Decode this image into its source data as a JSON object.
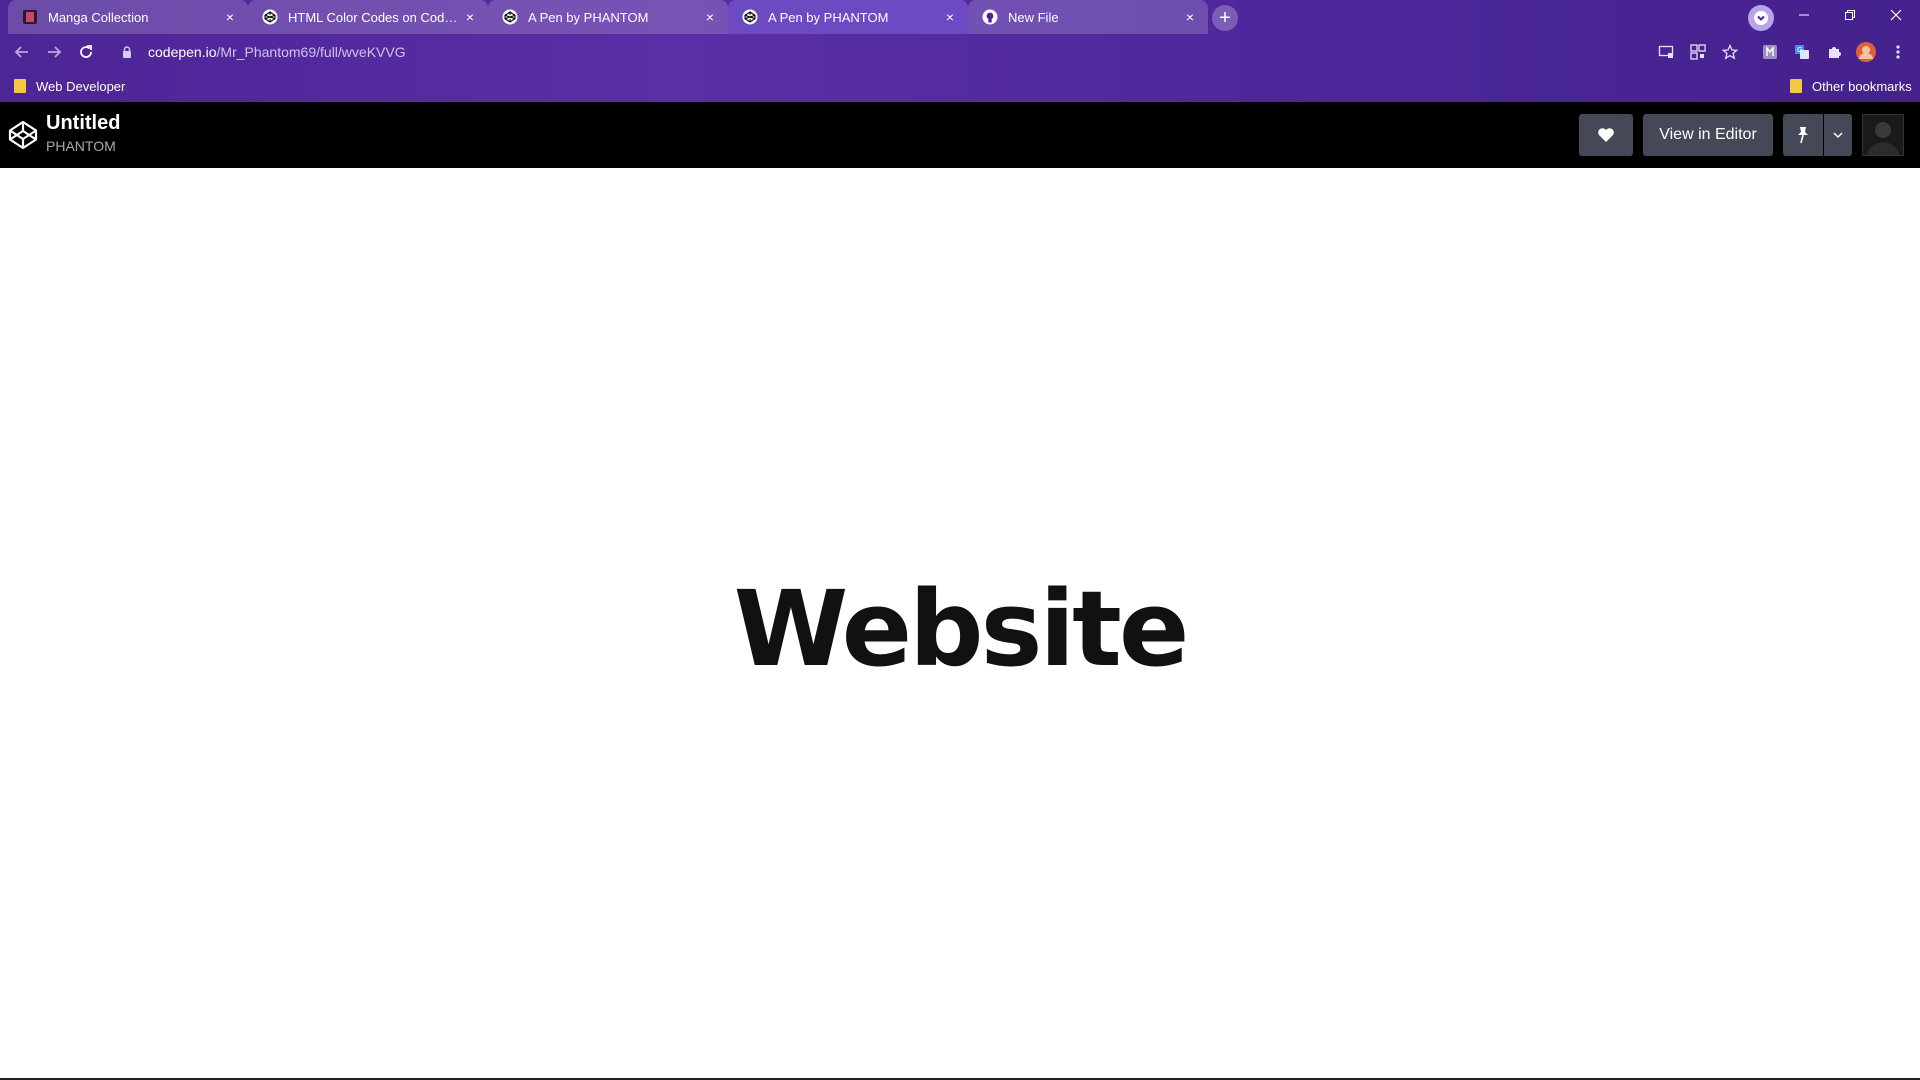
{
  "browser": {
    "tabs": [
      {
        "title": "Manga Collection",
        "icon": "manga-favicon",
        "active": false
      },
      {
        "title": "HTML Color Codes on CodePen",
        "icon": "codepen-icon",
        "active": false
      },
      {
        "title": "A Pen by PHANTOM",
        "icon": "codepen-icon",
        "active": false
      },
      {
        "title": "A Pen by PHANTOM",
        "icon": "codepen-icon",
        "active": true
      },
      {
        "title": "New File",
        "icon": "github-icon",
        "active": false
      }
    ],
    "close_glyph": "×",
    "new_tab_glyph": "+",
    "url_host": "codepen.io",
    "url_path": "/Mr_Phantom69/full/wveKVVG",
    "bookmarks": {
      "left": "Web Developer",
      "right": "Other bookmarks"
    }
  },
  "codepen": {
    "title": "Untitled",
    "user": "PHANTOM",
    "view_in_editor": "View in Editor"
  },
  "content": {
    "hero_text": "Website"
  },
  "colors": {
    "chrome_purple": "#5a2ea6",
    "active_tab": "#6b4ac2",
    "codepen_header": "#000000",
    "button_bg": "#444857"
  }
}
